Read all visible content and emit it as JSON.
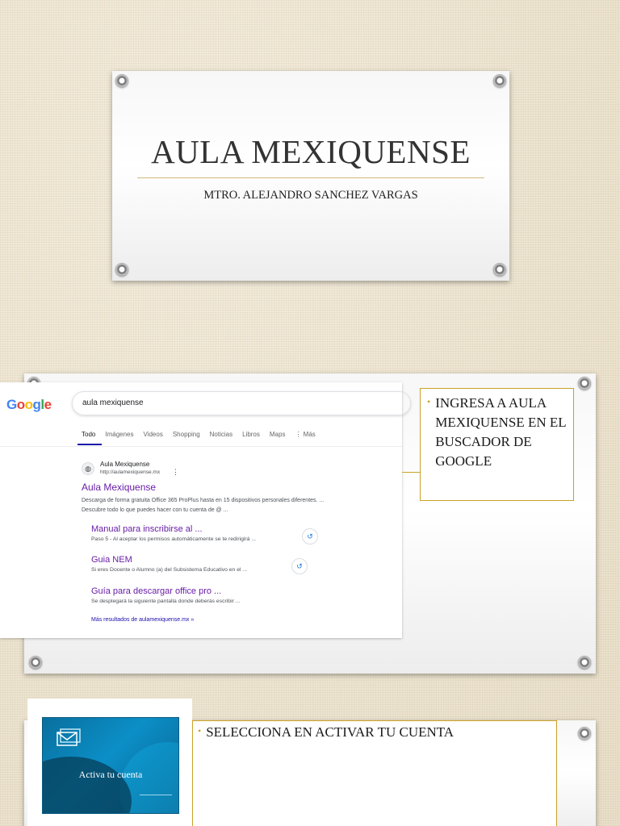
{
  "slide1": {
    "title": "AULA MEXIQUENSE",
    "subtitle": "MTRO. ALEJANDRO SANCHEZ VARGAS"
  },
  "slide2": {
    "google": {
      "logo": "Google",
      "logo_colors": [
        "#4285F4",
        "#EA4335",
        "#FBBC05",
        "#4285F4",
        "#34A853",
        "#EA4335"
      ],
      "query": "aula mexiquense",
      "tabs": [
        "Todo",
        "Imágenes",
        "Videos",
        "Shopping",
        "Noticias",
        "Libros",
        "Maps",
        "⋮ Más"
      ],
      "active_tab": "Todo",
      "site_name": "Aula Mexiquense",
      "site_url": "http://aulamexiquense.mx",
      "main_link": "Aula Mexiquense",
      "description_line1": "Descarga de forma gratuita Office 365 ProPlus hasta en 15 dispositivos personales diferentes. ...",
      "description_line2": "Descubre todo lo que puedes hacer con tu cuenta de @ ...",
      "sublinks": [
        {
          "title": "Manual para inscribirse al ...",
          "desc": "Paso 5 - Al aceptar los permisos automáticamente se te redirigirá ..."
        },
        {
          "title": "Guia NEM",
          "desc": "Si eres Docente o Alumno (a) del Subsistema Educativo en el ..."
        },
        {
          "title": "Guía para descargar office pro ...",
          "desc": "Se desplegará la siguiente pantalla donde deberás escribir ..."
        }
      ],
      "more_results": "Más resultados de aulamexiquense.mx »"
    },
    "callout": "INGRESA A AULA MEXIQUENSE EN EL BUSCADOR DE GOOGLE"
  },
  "slide3": {
    "thumbnail_label": "Activa tu cuenta",
    "callout": "SELECCIONA EN ACTIVAR TU CUENTA"
  },
  "colors": {
    "accent": "#c9a227",
    "visited_link": "#681da8",
    "link": "#1a0dab"
  }
}
